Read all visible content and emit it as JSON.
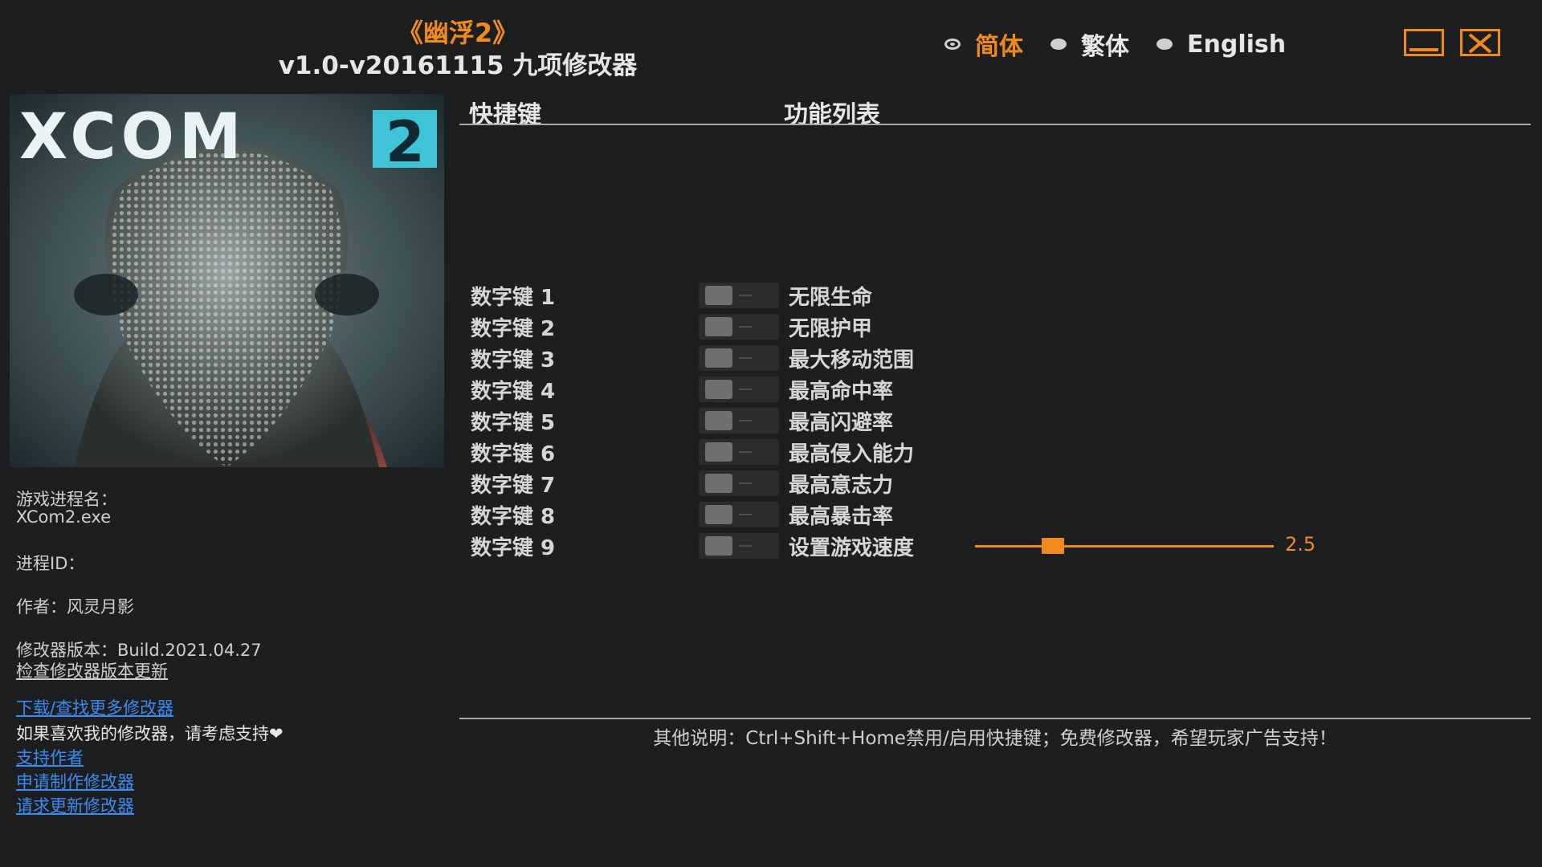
{
  "window": {
    "title": "《幽浮2》",
    "subtitle": "v1.0-v20161115 九项修改器"
  },
  "languages": [
    {
      "label": "简体",
      "selected": true
    },
    {
      "label": "繁体",
      "selected": false
    },
    {
      "label": "English",
      "selected": false
    }
  ],
  "controls": {
    "minimize_icon": "minimize-icon",
    "close_icon": "close-icon"
  },
  "cover": {
    "logo_text": "XCOM",
    "logo_number": "2"
  },
  "info": {
    "process_label": "游戏进程名：",
    "process_value": "XCom2.exe",
    "pid_label": "进程ID：",
    "author": "作者：风灵月影",
    "version": "修改器版本：Build.2021.04.27",
    "check_update": "检查修改器版本更新",
    "download_more": "下载/查找更多修改器",
    "support_text": "如果喜欢我的修改器，请考虑支持❤",
    "support_author": "支持作者",
    "request_make": "申请制作修改器",
    "request_update": "请求更新修改器"
  },
  "headers": {
    "hotkey": "快捷键",
    "features": "功能列表"
  },
  "cheats": [
    {
      "hotkey": "数字键 1",
      "name": "无限生命"
    },
    {
      "hotkey": "数字键 2",
      "name": "无限护甲"
    },
    {
      "hotkey": "数字键 3",
      "name": "最大移动范围"
    },
    {
      "hotkey": "数字键 4",
      "name": "最高命中率"
    },
    {
      "hotkey": "数字键 5",
      "name": "最高闪避率"
    },
    {
      "hotkey": "数字键 6",
      "name": "最高侵入能力"
    },
    {
      "hotkey": "数字键 7",
      "name": "最高意志力"
    },
    {
      "hotkey": "数字键 8",
      "name": "最高暴击率"
    },
    {
      "hotkey": "数字键 9",
      "name": "设置游戏速度"
    }
  ],
  "speed_slider": {
    "value": "2.5",
    "fraction": 0.26
  },
  "footer": {
    "note": "其他说明：Ctrl+Shift+Home禁用/启用快捷键；免费修改器，希望玩家广告支持！"
  },
  "colors": {
    "accent": "#f08a1c",
    "link": "#3d8bf2",
    "background": "#1d1e20"
  }
}
